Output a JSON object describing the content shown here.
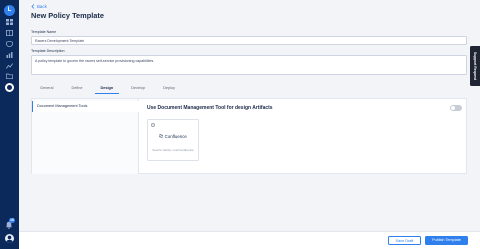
{
  "header": {
    "back_label": "Back",
    "title": "New Policy Template"
  },
  "form": {
    "name_label": "Template Name",
    "name_value": "Racers Development Template",
    "description_label": "Template Description",
    "description_value": "A policy template to govern the racers self-service provisioning capabilities"
  },
  "tabs": [
    {
      "label": "General",
      "active": false
    },
    {
      "label": "Define",
      "active": false
    },
    {
      "label": "Design",
      "active": true
    },
    {
      "label": "Develop",
      "active": false
    },
    {
      "label": "Deploy",
      "active": false
    }
  ],
  "design": {
    "sidebar_item": "Document Management Tools",
    "section_title": "Use Document Management Tool for design Artifacts",
    "toggle_on": false,
    "tool": {
      "name": "Confluence",
      "subtitle": "Source: Entity: overConfluence",
      "icon": "confluence-icon"
    }
  },
  "support": {
    "label": "Support Request"
  },
  "footer": {
    "save_label": "Save Draft",
    "publish_label": "Publish Template"
  },
  "rail": {
    "logo_letter": "L",
    "notification_count": "16",
    "icons": [
      "grid-icon",
      "book-icon",
      "shield-icon",
      "chart-icon",
      "analytics-icon",
      "folder-icon",
      "settings-icon"
    ]
  },
  "colors": {
    "accent": "#2f80ed",
    "rail": "#0b2a5b"
  }
}
